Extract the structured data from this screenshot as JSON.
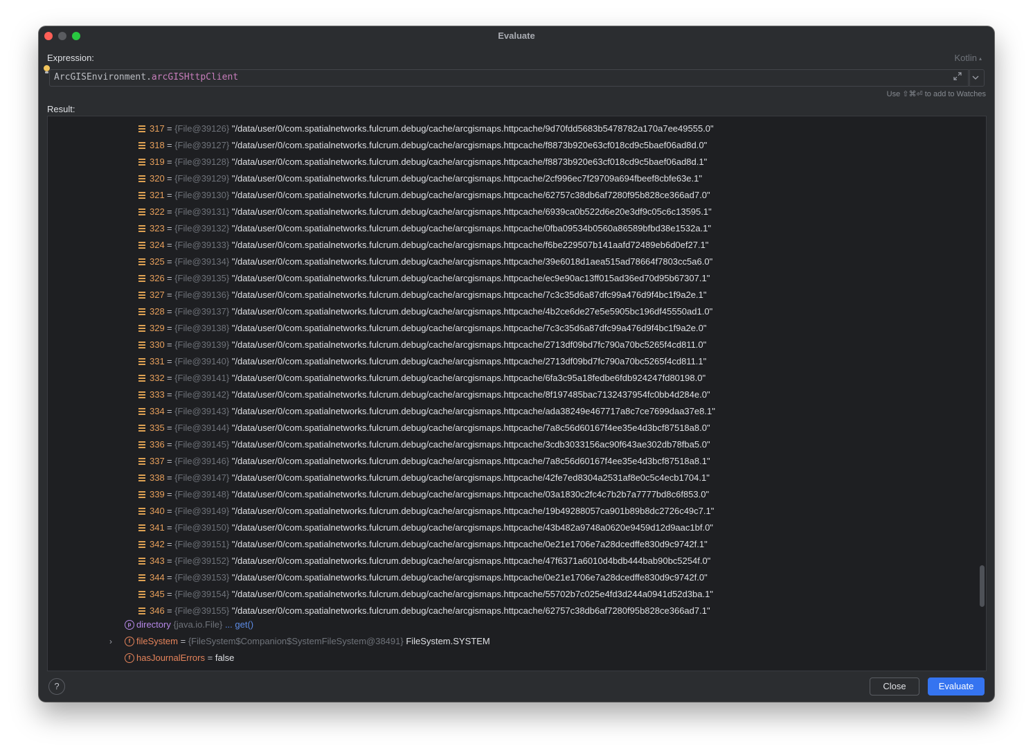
{
  "window": {
    "title": "Evaluate"
  },
  "expression": {
    "label": "Expression:",
    "language": "Kotlin",
    "receiver": "ArcGISEnvironment",
    "dot": ".",
    "property": "arcGISHttpClient",
    "hint": "Use ⇧⌘⏎ to add to Watches"
  },
  "result": {
    "label": "Result:",
    "list_items": [
      {
        "index": "317",
        "ref": "{File@39126}",
        "value": "\"/data/user/0/com.spatialnetworks.fulcrum.debug/cache/arcgismaps.httpcache/9d70fdd5683b5478782a170a7ee49555.0\""
      },
      {
        "index": "318",
        "ref": "{File@39127}",
        "value": "\"/data/user/0/com.spatialnetworks.fulcrum.debug/cache/arcgismaps.httpcache/f8873b920e63cf018cd9c5baef06ad8d.0\""
      },
      {
        "index": "319",
        "ref": "{File@39128}",
        "value": "\"/data/user/0/com.spatialnetworks.fulcrum.debug/cache/arcgismaps.httpcache/f8873b920e63cf018cd9c5baef06ad8d.1\""
      },
      {
        "index": "320",
        "ref": "{File@39129}",
        "value": "\"/data/user/0/com.spatialnetworks.fulcrum.debug/cache/arcgismaps.httpcache/2cf996ec7f29709a694fbeef8cbfe63e.1\""
      },
      {
        "index": "321",
        "ref": "{File@39130}",
        "value": "\"/data/user/0/com.spatialnetworks.fulcrum.debug/cache/arcgismaps.httpcache/62757c38db6af7280f95b828ce366ad7.0\""
      },
      {
        "index": "322",
        "ref": "{File@39131}",
        "value": "\"/data/user/0/com.spatialnetworks.fulcrum.debug/cache/arcgismaps.httpcache/6939ca0b522d6e20e3df9c05c6c13595.1\""
      },
      {
        "index": "323",
        "ref": "{File@39132}",
        "value": "\"/data/user/0/com.spatialnetworks.fulcrum.debug/cache/arcgismaps.httpcache/0fba09534b0560a86589bfbd38e1532a.1\""
      },
      {
        "index": "324",
        "ref": "{File@39133}",
        "value": "\"/data/user/0/com.spatialnetworks.fulcrum.debug/cache/arcgismaps.httpcache/f6be229507b141aafd72489eb6d0ef27.1\""
      },
      {
        "index": "325",
        "ref": "{File@39134}",
        "value": "\"/data/user/0/com.spatialnetworks.fulcrum.debug/cache/arcgismaps.httpcache/39e6018d1aea515ad78664f7803cc5a6.0\""
      },
      {
        "index": "326",
        "ref": "{File@39135}",
        "value": "\"/data/user/0/com.spatialnetworks.fulcrum.debug/cache/arcgismaps.httpcache/ec9e90ac13ff015ad36ed70d95b67307.1\""
      },
      {
        "index": "327",
        "ref": "{File@39136}",
        "value": "\"/data/user/0/com.spatialnetworks.fulcrum.debug/cache/arcgismaps.httpcache/7c3c35d6a87dfc99a476d9f4bc1f9a2e.1\""
      },
      {
        "index": "328",
        "ref": "{File@39137}",
        "value": "\"/data/user/0/com.spatialnetworks.fulcrum.debug/cache/arcgismaps.httpcache/4b2ce6de27e5e5905bc196df45550ad1.0\""
      },
      {
        "index": "329",
        "ref": "{File@39138}",
        "value": "\"/data/user/0/com.spatialnetworks.fulcrum.debug/cache/arcgismaps.httpcache/7c3c35d6a87dfc99a476d9f4bc1f9a2e.0\""
      },
      {
        "index": "330",
        "ref": "{File@39139}",
        "value": "\"/data/user/0/com.spatialnetworks.fulcrum.debug/cache/arcgismaps.httpcache/2713df09bd7fc790a70bc5265f4cd811.0\""
      },
      {
        "index": "331",
        "ref": "{File@39140}",
        "value": "\"/data/user/0/com.spatialnetworks.fulcrum.debug/cache/arcgismaps.httpcache/2713df09bd7fc790a70bc5265f4cd811.1\""
      },
      {
        "index": "332",
        "ref": "{File@39141}",
        "value": "\"/data/user/0/com.spatialnetworks.fulcrum.debug/cache/arcgismaps.httpcache/6fa3c95a18fedbe6fdb924247fd80198.0\""
      },
      {
        "index": "333",
        "ref": "{File@39142}",
        "value": "\"/data/user/0/com.spatialnetworks.fulcrum.debug/cache/arcgismaps.httpcache/8f197485bac7132437954fc0bb4d284e.0\""
      },
      {
        "index": "334",
        "ref": "{File@39143}",
        "value": "\"/data/user/0/com.spatialnetworks.fulcrum.debug/cache/arcgismaps.httpcache/ada38249e467717a8c7ce7699daa37e8.1\""
      },
      {
        "index": "335",
        "ref": "{File@39144}",
        "value": "\"/data/user/0/com.spatialnetworks.fulcrum.debug/cache/arcgismaps.httpcache/7a8c56d60167f4ee35e4d3bcf87518a8.0\""
      },
      {
        "index": "336",
        "ref": "{File@39145}",
        "value": "\"/data/user/0/com.spatialnetworks.fulcrum.debug/cache/arcgismaps.httpcache/3cdb3033156ac90f643ae302db78fba5.0\""
      },
      {
        "index": "337",
        "ref": "{File@39146}",
        "value": "\"/data/user/0/com.spatialnetworks.fulcrum.debug/cache/arcgismaps.httpcache/7a8c56d60167f4ee35e4d3bcf87518a8.1\""
      },
      {
        "index": "338",
        "ref": "{File@39147}",
        "value": "\"/data/user/0/com.spatialnetworks.fulcrum.debug/cache/arcgismaps.httpcache/42fe7ed8304a2531af8e0c5c4ecb1704.1\""
      },
      {
        "index": "339",
        "ref": "{File@39148}",
        "value": "\"/data/user/0/com.spatialnetworks.fulcrum.debug/cache/arcgismaps.httpcache/03a1830c2fc4c7b2b7a7777bd8c6f853.0\""
      },
      {
        "index": "340",
        "ref": "{File@39149}",
        "value": "\"/data/user/0/com.spatialnetworks.fulcrum.debug/cache/arcgismaps.httpcache/19b49288057ca901b89b8dc2726c49c7.1\""
      },
      {
        "index": "341",
        "ref": "{File@39150}",
        "value": "\"/data/user/0/com.spatialnetworks.fulcrum.debug/cache/arcgismaps.httpcache/43b482a9748a0620e9459d12d9aac1bf.0\""
      },
      {
        "index": "342",
        "ref": "{File@39151}",
        "value": "\"/data/user/0/com.spatialnetworks.fulcrum.debug/cache/arcgismaps.httpcache/0e21e1706e7a28dcedffe830d9c9742f.1\""
      },
      {
        "index": "343",
        "ref": "{File@39152}",
        "value": "\"/data/user/0/com.spatialnetworks.fulcrum.debug/cache/arcgismaps.httpcache/47f6371a6010d4bdb444bab90bc5254f.0\""
      },
      {
        "index": "344",
        "ref": "{File@39153}",
        "value": "\"/data/user/0/com.spatialnetworks.fulcrum.debug/cache/arcgismaps.httpcache/0e21e1706e7a28dcedffe830d9c9742f.0\""
      },
      {
        "index": "345",
        "ref": "{File@39154}",
        "value": "\"/data/user/0/com.spatialnetworks.fulcrum.debug/cache/arcgismaps.httpcache/55702b7c025e4fd3d244a0941d52d3ba.1\""
      },
      {
        "index": "346",
        "ref": "{File@39155}",
        "value": "\"/data/user/0/com.spatialnetworks.fulcrum.debug/cache/arcgismaps.httpcache/62757c38db6af7280f95b828ce366ad7.1\""
      }
    ],
    "directory": {
      "icon_letter": "p",
      "name": "directory",
      "type": "{java.io.File}",
      "getter": "... get()"
    },
    "file_system": {
      "icon_letter": "f",
      "name": "fileSystem",
      "eq": "=",
      "ref": "{FileSystem$Companion$SystemFileSystem@38491}",
      "value": "FileSystem.SYSTEM"
    },
    "journal_errors": {
      "icon_letter": "f",
      "name": "hasJournalErrors",
      "eq": "=",
      "value": "false"
    }
  },
  "footer": {
    "help": "?",
    "close_label": "Close",
    "evaluate_label": "Evaluate"
  },
  "colors": {
    "background": "#2b2d30",
    "tree_background": "#1e1f22",
    "index": "#e8a05c",
    "accent": "#3574f0",
    "property": "#c77dbb"
  }
}
